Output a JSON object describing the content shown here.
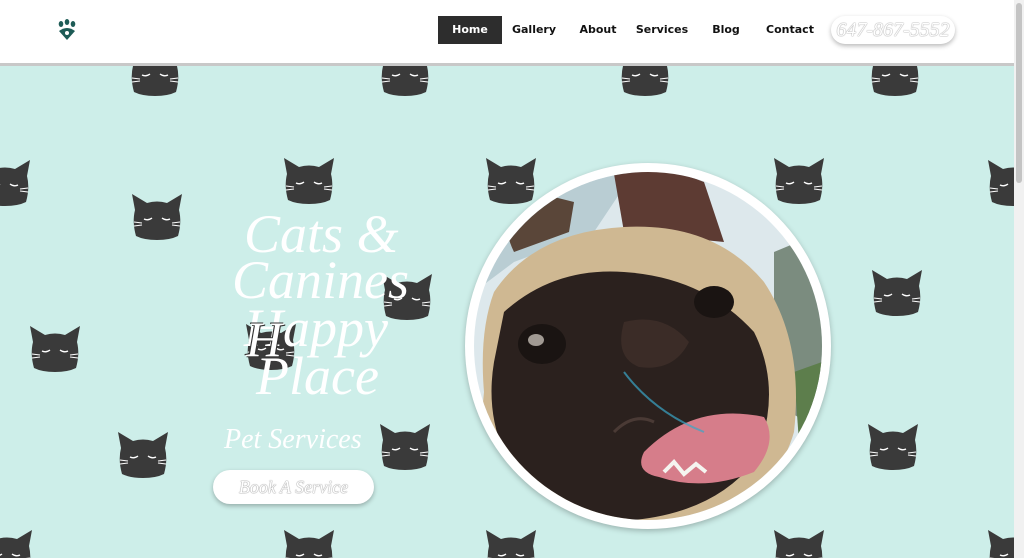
{
  "logo": {
    "icon": "paw-print-icon"
  },
  "nav": {
    "items": [
      {
        "label": "Home",
        "active": true
      },
      {
        "label": "Gallery",
        "active": false
      },
      {
        "label": "About",
        "active": false
      },
      {
        "label": "Services",
        "active": false
      },
      {
        "label": "Blog",
        "active": false
      },
      {
        "label": "Contact",
        "active": false
      }
    ]
  },
  "phone": "647-867-5552",
  "hero": {
    "title_line1": "Cats &",
    "title_line2": "Canines",
    "title_line3": "Happy",
    "title_line4": "Place",
    "overlay_letter": "H",
    "subtitle": "Pet Services",
    "cta": "Book A Service",
    "pattern_icon": "cat-face-icon",
    "photo_subject": "french-bulldog-photo"
  },
  "colors": {
    "hero_bg": "#cdeee9",
    "cat": "#3a3a3a",
    "nav_active_bg": "#2d2d2d"
  }
}
